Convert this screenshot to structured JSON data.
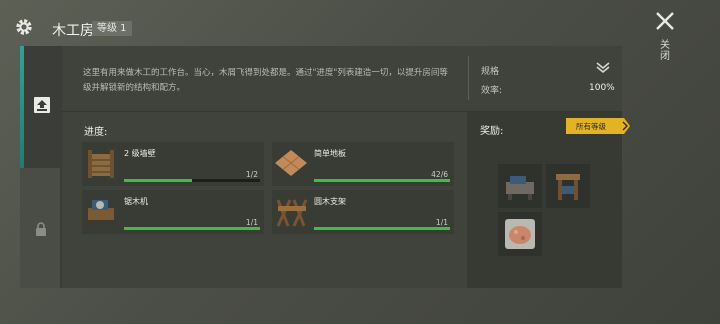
{
  "header": {
    "title": "木工房",
    "level_badge": "等级 1",
    "close_label": "关闭"
  },
  "description": "这里有用来做木工的工作台。当心，木屑飞得到处都是。通过\"进度\"列表建造一切，以提升房间等级并解锁新的结构和配方。",
  "stats": {
    "spec_label": "规格",
    "efficiency_label": "效率:",
    "efficiency_value": "100%"
  },
  "progress": {
    "label": "进度:",
    "items": [
      {
        "name": "2 级墙壁",
        "count": "1/2",
        "fraction": 0.5,
        "icon": "wall-icon"
      },
      {
        "name": "简单地板",
        "count": "42/6",
        "fraction": 1.0,
        "icon": "floor-icon"
      },
      {
        "name": "锯木机",
        "count": "1/1",
        "fraction": 1.0,
        "icon": "sawmill-icon"
      },
      {
        "name": "圆木支架",
        "count": "1/1",
        "fraction": 1.0,
        "icon": "log-rack-icon"
      }
    ]
  },
  "rewards": {
    "label": "奖励:",
    "all_levels_button": "所有等级",
    "items": [
      {
        "icon": "workbench-reward-icon"
      },
      {
        "icon": "press-reward-icon"
      },
      {
        "icon": "sawdust-reward-icon"
      }
    ]
  },
  "colors": {
    "accent_teal": "#2ea398",
    "progress_green": "#3fbf3a",
    "gold_button": "#e3b324"
  }
}
